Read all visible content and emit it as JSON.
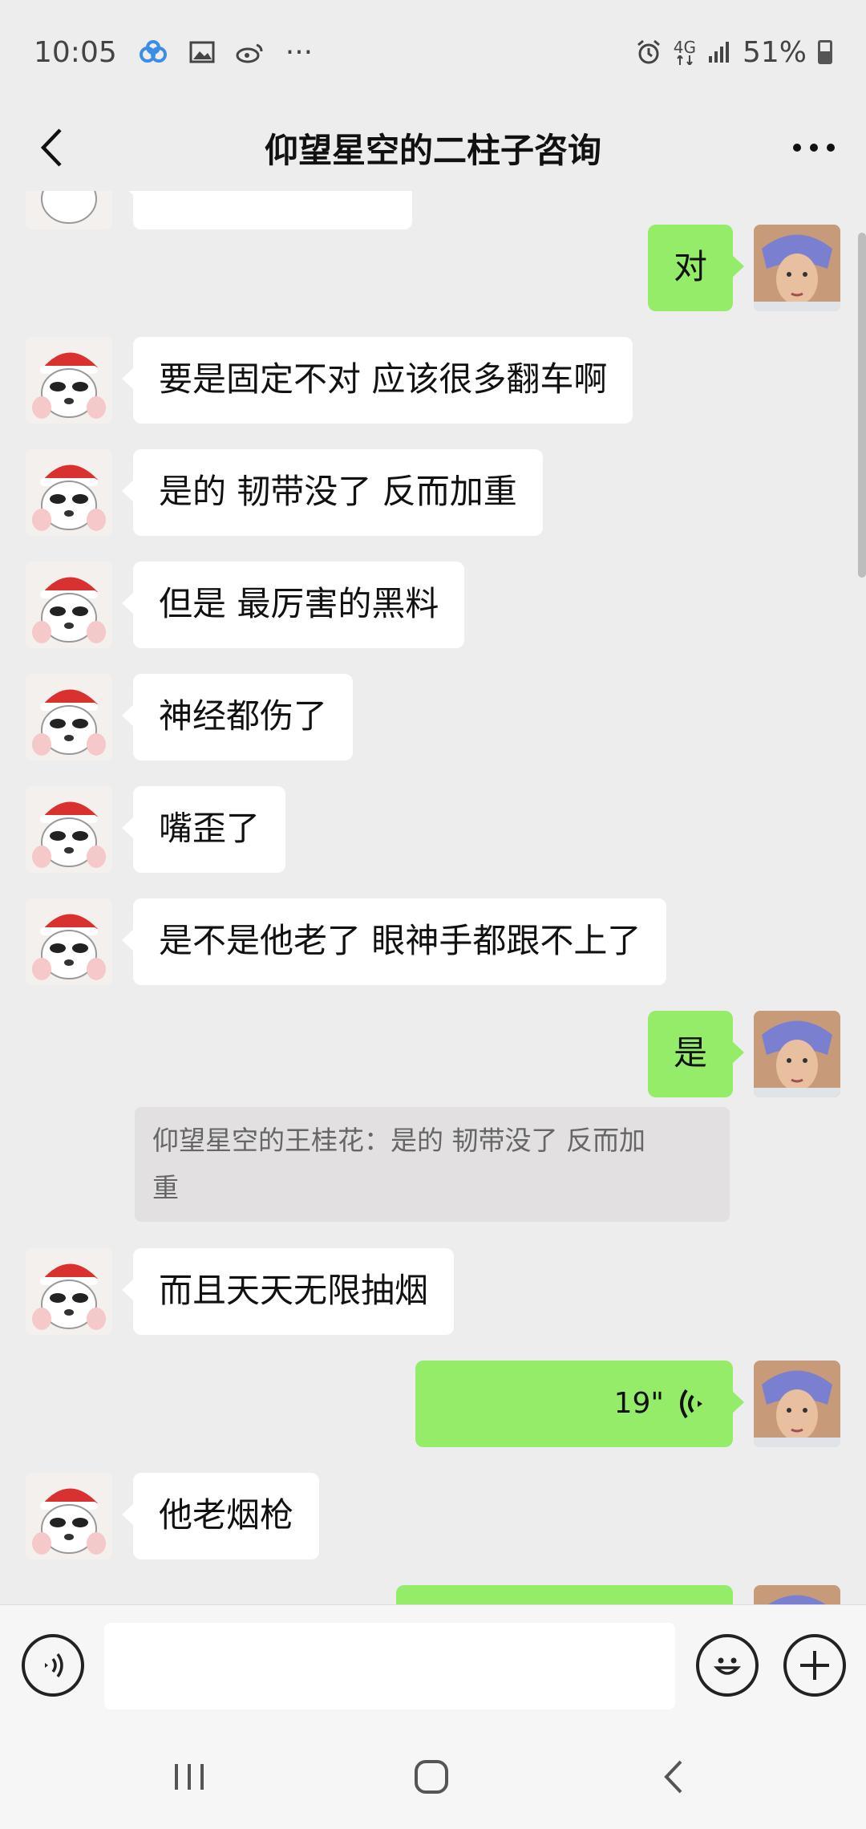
{
  "status_bar": {
    "time": "10:05",
    "network": "4G",
    "battery": "51%",
    "more": "···"
  },
  "header": {
    "title": "仰望星空的二柱子咨询"
  },
  "messages": [
    {
      "side": "right",
      "text": "对"
    },
    {
      "side": "left",
      "text": "要是固定不对 应该很多翻车啊"
    },
    {
      "side": "left",
      "text": "是的 韧带没了 反而加重"
    },
    {
      "side": "left",
      "text": "但是 最厉害的黑料"
    },
    {
      "side": "left",
      "text": "神经都伤了"
    },
    {
      "side": "left",
      "text": "嘴歪了"
    },
    {
      "side": "left",
      "text": "是不是他老了 眼神手都跟不上了"
    },
    {
      "side": "right",
      "text": "是"
    },
    {
      "side": "left",
      "text": "而且天天无限抽烟"
    },
    {
      "side": "right",
      "voice_duration": "19\""
    },
    {
      "side": "left",
      "text": "他老烟枪"
    }
  ],
  "quote": {
    "line1": "仰望星空的王桂花：是的 韧带没了 反而加",
    "line2": "重"
  },
  "input": {
    "placeholder": "",
    "value": ""
  },
  "colors": {
    "chat_bg": "#ededed",
    "incoming_bubble": "#ffffff",
    "outgoing_bubble": "#95ec69",
    "quote_bg": "#e2e0e0"
  }
}
